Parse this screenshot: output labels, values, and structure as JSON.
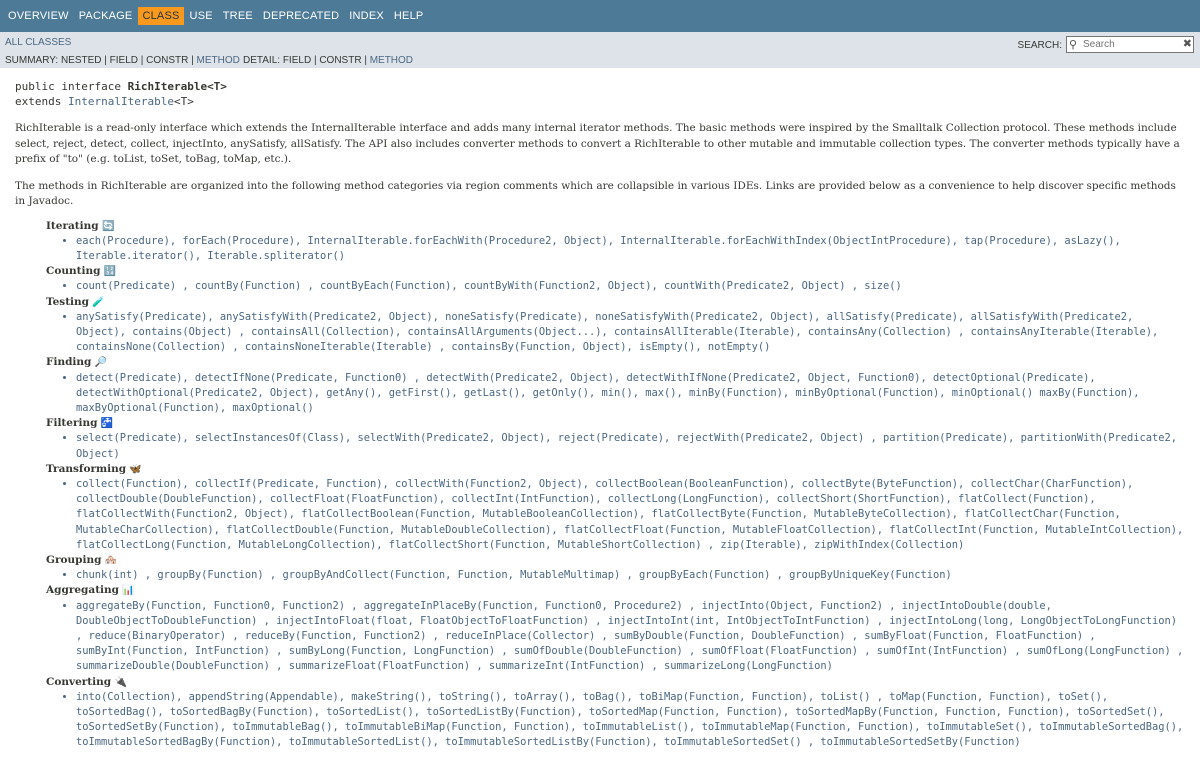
{
  "topnav": {
    "items": [
      "OVERVIEW",
      "PACKAGE",
      "CLASS",
      "USE",
      "TREE",
      "DEPRECATED",
      "INDEX",
      "HELP"
    ],
    "active": "CLASS"
  },
  "subnav": {
    "all_classes": "ALL CLASSES",
    "summary_prefix": "SUMMARY: NESTED | FIELD | CONSTR |",
    "summary_method": "METHOD",
    "detail_prefix": "DETAIL: FIELD | CONSTR |",
    "detail_method": "METHOD",
    "search_label": "SEARCH:",
    "search_placeholder": "Search"
  },
  "signature": {
    "line1_prefix": "public interface ",
    "name": "RichIterable<T>",
    "extends_kw": "extends ",
    "extends_link": "InternalIterable",
    "extends_suffix": "<T>"
  },
  "description": "RichIterable is a read-only interface which extends the InternalIterable interface and adds many internal iterator methods. The basic methods were inspired by the Smalltalk Collection protocol. These methods include select, reject, detect, collect, injectInto, anySatisfy, allSatisfy. The API also includes converter methods to convert a RichIterable to other mutable and immutable collection types. The converter methods typically have a prefix of \"to\" (e.g. toList, toSet, toBag, toMap, etc.).",
  "description2": "The methods in RichIterable are organized into the following method categories via region comments which are collapsible in various IDEs. Links are provided below as a convenience to help discover specific methods in Javadoc.",
  "categories": [
    {
      "title": "Iterating",
      "icon": "🔄",
      "methods": "each(Procedure), forEach(Procedure), InternalIterable.forEachWith(Procedure2, Object), InternalIterable.forEachWithIndex(ObjectIntProcedure), tap(Procedure), asLazy(), Iterable.iterator(), Iterable.spliterator()"
    },
    {
      "title": "Counting",
      "icon": "🔢",
      "methods": "count(Predicate) , countBy(Function) , countByEach(Function), countByWith(Function2, Object), countWith(Predicate2, Object) , size()"
    },
    {
      "title": "Testing",
      "icon": "🧪",
      "methods": "anySatisfy(Predicate), anySatisfyWith(Predicate2, Object), noneSatisfy(Predicate), noneSatisfyWith(Predicate2, Object), allSatisfy(Predicate), allSatisfyWith(Predicate2, Object), contains(Object) , containsAll(Collection), containsAllArguments(Object...), containsAllIterable(Iterable), containsAny(Collection) , containsAnyIterable(Iterable), containsNone(Collection) , containsNoneIterable(Iterable) , containsBy(Function, Object), isEmpty(), notEmpty()"
    },
    {
      "title": "Finding",
      "icon": "🔎",
      "methods": "detect(Predicate), detectIfNone(Predicate, Function0) , detectWith(Predicate2, Object), detectWithIfNone(Predicate2, Object, Function0), detectOptional(Predicate), detectWithOptional(Predicate2, Object), getAny(), getFirst(), getLast(), getOnly(), min(), max(), minBy(Function), minByOptional(Function), minOptional() maxBy(Function), maxByOptional(Function), maxOptional()"
    },
    {
      "title": "Filtering",
      "icon": "🚰",
      "methods": "select(Predicate), selectInstancesOf(Class), selectWith(Predicate2, Object), reject(Predicate), rejectWith(Predicate2, Object) , partition(Predicate), partitionWith(Predicate2, Object)"
    },
    {
      "title": "Transforming",
      "icon": "🦋",
      "methods": "collect(Function), collectIf(Predicate, Function), collectWith(Function2, Object), collectBoolean(BooleanFunction), collectByte(ByteFunction), collectChar(CharFunction), collectDouble(DoubleFunction), collectFloat(FloatFunction), collectInt(IntFunction), collectLong(LongFunction), collectShort(ShortFunction), flatCollect(Function), flatCollectWith(Function2, Object), flatCollectBoolean(Function, MutableBooleanCollection), flatCollectByte(Function, MutableByteCollection), flatCollectChar(Function, MutableCharCollection), flatCollectDouble(Function, MutableDoubleCollection), flatCollectFloat(Function, MutableFloatCollection), flatCollectInt(Function, MutableIntCollection), flatCollectLong(Function, MutableLongCollection), flatCollectShort(Function, MutableShortCollection) , zip(Iterable), zipWithIndex(Collection)"
    },
    {
      "title": "Grouping",
      "icon": "🏘️",
      "methods": "chunk(int) , groupBy(Function) , groupByAndCollect(Function, Function, MutableMultimap) , groupByEach(Function) , groupByUniqueKey(Function)"
    },
    {
      "title": "Aggregating",
      "icon": "📊",
      "methods": "aggregateBy(Function, Function0, Function2) , aggregateInPlaceBy(Function, Function0, Procedure2) , injectInto(Object, Function2) , injectIntoDouble(double, DoubleObjectToDoubleFunction) , injectIntoFloat(float, FloatObjectToFloatFunction) , injectIntoInt(int, IntObjectToIntFunction) , injectIntoLong(long, LongObjectToLongFunction) , reduce(BinaryOperator) , reduceBy(Function, Function2) , reduceInPlace(Collector) , sumByDouble(Function, DoubleFunction) , sumByFloat(Function, FloatFunction) , sumByInt(Function, IntFunction) , sumByLong(Function, LongFunction) , sumOfDouble(DoubleFunction) , sumOfFloat(FloatFunction) , sumOfInt(IntFunction) , sumOfLong(LongFunction) , summarizeDouble(DoubleFunction) , summarizeFloat(FloatFunction) , summarizeInt(IntFunction) , summarizeLong(LongFunction)"
    },
    {
      "title": "Converting",
      "icon": "🔌",
      "methods": "into(Collection), appendString(Appendable), makeString(), toString(), toArray(), toBag(), toBiMap(Function, Function), toList() , toMap(Function, Function), toSet(), toSortedBag(), toSortedBagBy(Function), toSortedList(), toSortedListBy(Function), toSortedMap(Function, Function), toSortedMapBy(Function, Function, Function), toSortedSet(), toSortedSetBy(Function), toImmutableBag(), toImmutableBiMap(Function, Function), toImmutableList(), toImmutableMap(Function, Function), toImmutableSet(), toImmutableSortedBag(), toImmutableSortedBagBy(Function), toImmutableSortedList(), toImmutableSortedListBy(Function), toImmutableSortedSet() , toImmutableSortedSetBy(Function)"
    }
  ]
}
